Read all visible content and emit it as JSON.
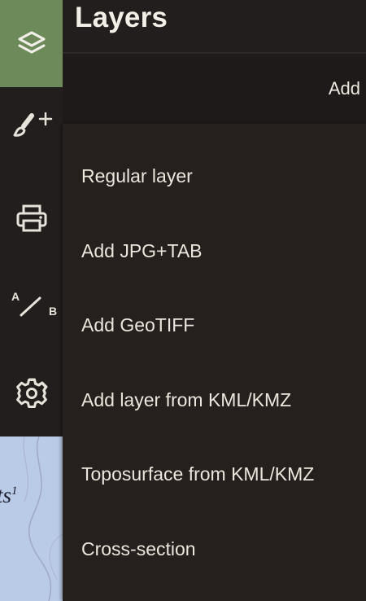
{
  "header": {
    "title": "Layers"
  },
  "subheader": {
    "add_label": "Add"
  },
  "toolbar": {
    "tools": [
      {
        "name": "layers",
        "icon": "layers-icon",
        "active": true
      },
      {
        "name": "draw",
        "icon": "brush-plus-icon",
        "active": false
      },
      {
        "name": "print",
        "icon": "printer-icon",
        "active": false
      },
      {
        "name": "measure",
        "icon": "a-to-b-icon",
        "active": false,
        "label_a": "A",
        "label_b": "B"
      },
      {
        "name": "settings",
        "icon": "gear-icon",
        "active": false
      }
    ]
  },
  "map": {
    "label": "ts",
    "label_sup": "1"
  },
  "menu": {
    "items": [
      {
        "label": "Regular layer"
      },
      {
        "label": "Add JPG+TAB"
      },
      {
        "label": "Add GeoTIFF"
      },
      {
        "label": "Add layer from KML/KMZ"
      },
      {
        "label": "Toposurface from KML/KMZ"
      },
      {
        "label": "Cross-section"
      }
    ]
  },
  "colors": {
    "active_tool": "#6d8a5b",
    "panel": "#231f1e",
    "text": "#ece6dc",
    "map_water": "#b9cbe6"
  }
}
